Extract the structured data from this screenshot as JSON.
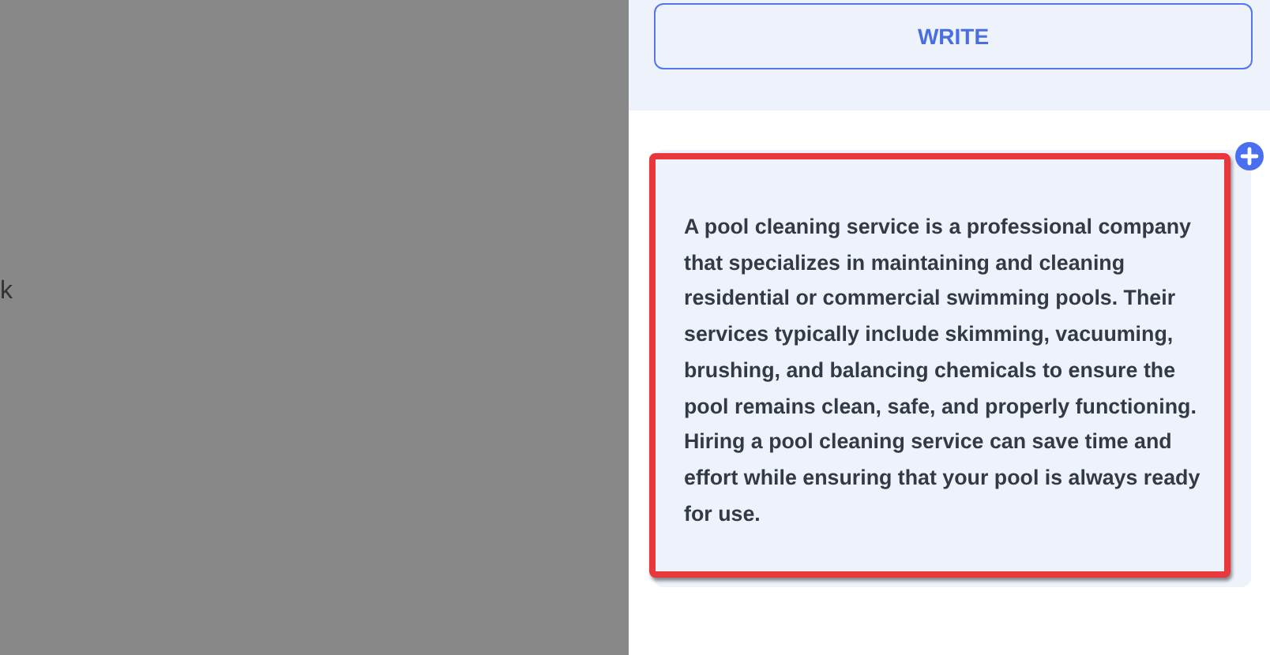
{
  "backdrop": {
    "text": "k"
  },
  "write_button": {
    "label": "WRITE"
  },
  "card": {
    "text": "A pool cleaning service is a professional company that specializes in maintaining and cleaning residential or commercial swimming pools. Their services typically include skimming, vacuuming, brushing, and balancing chemicals to ensure the pool remains clean, safe, and properly functioning. Hiring a pool cleaning service can save time and effort while ensuring that your pool is always ready for use.",
    "selected": true
  }
}
